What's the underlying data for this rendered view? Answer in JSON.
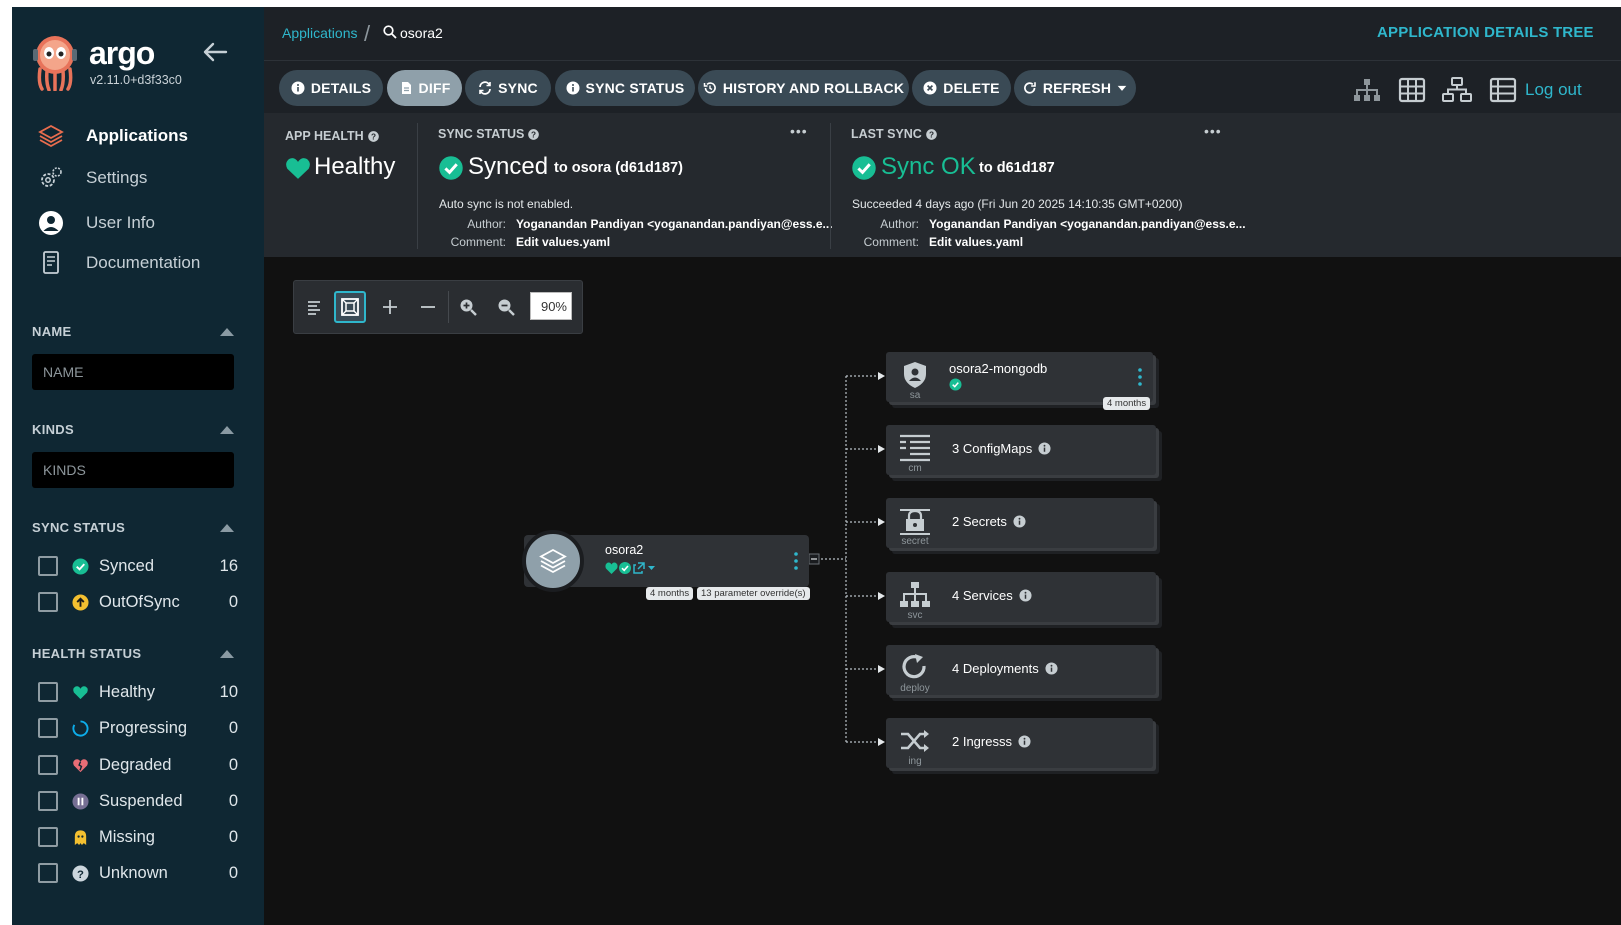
{
  "sidebar": {
    "brand": "argo",
    "version": "v2.11.0+d3f33c0",
    "nav": [
      {
        "label": "Applications",
        "icon": "layers-icon",
        "active": true
      },
      {
        "label": "Settings",
        "icon": "gear-icon"
      },
      {
        "label": "User Info",
        "icon": "user-circle-icon"
      },
      {
        "label": "Documentation",
        "icon": "book-icon"
      }
    ],
    "name_filter": {
      "title": "NAME",
      "placeholder": "NAME"
    },
    "kinds_filter": {
      "title": "KINDS",
      "placeholder": "KINDS"
    },
    "sync_status": {
      "title": "SYNC STATUS",
      "items": [
        {
          "label": "Synced",
          "count": "16",
          "icon": "check-circle-icon",
          "color": "#18be94"
        },
        {
          "label": "OutOfSync",
          "count": "0",
          "icon": "arrow-up-circle-icon",
          "color": "#f4c030"
        }
      ]
    },
    "health_status": {
      "title": "HEALTH STATUS",
      "items": [
        {
          "label": "Healthy",
          "count": "10",
          "icon": "heart-icon",
          "color": "#18be94"
        },
        {
          "label": "Progressing",
          "count": "0",
          "icon": "circle-notch-icon",
          "color": "#0dadea"
        },
        {
          "label": "Degraded",
          "count": "0",
          "icon": "heart-broken-icon",
          "color": "#e96d76"
        },
        {
          "label": "Suspended",
          "count": "0",
          "icon": "pause-circle-icon",
          "color": "#766f94"
        },
        {
          "label": "Missing",
          "count": "0",
          "icon": "ghost-icon",
          "color": "#f4c030"
        },
        {
          "label": "Unknown",
          "count": "0",
          "icon": "question-circle-icon",
          "color": "#ccd6dd"
        }
      ]
    }
  },
  "topbar": {
    "breadcrumb_link": "Applications",
    "breadcrumb_current": "osora2",
    "title": "APPLICATION DETAILS TREE"
  },
  "toolbar": {
    "details": "DETAILS",
    "diff": "DIFF",
    "sync": "SYNC",
    "sync_status": "SYNC STATUS",
    "history": "HISTORY AND ROLLBACK",
    "delete": "DELETE",
    "refresh": "REFRESH",
    "logout": "Log out"
  },
  "status": {
    "app_health": {
      "title": "APP HEALTH",
      "value": "Healthy"
    },
    "sync": {
      "title": "SYNC STATUS",
      "value": "Synced",
      "target": "to osora (d61d187)",
      "auto": "Auto sync is not enabled.",
      "author_label": "Author:",
      "author": "Yoganandan Pandiyan <yoganandan.pandiyan@ess.e...",
      "comment_label": "Comment:",
      "comment": "Edit values.yaml"
    },
    "last_sync": {
      "title": "LAST SYNC",
      "value": "Sync OK",
      "target": "to d61d187",
      "when": "Succeeded 4 days ago (Fri Jun 20 2025 14:10:35 GMT+0200)",
      "author_label": "Author:",
      "author": "Yoganandan Pandiyan <yoganandan.pandiyan@ess.e...",
      "comment_label": "Comment:",
      "comment": "Edit values.yaml"
    }
  },
  "graph": {
    "zoom": "90%",
    "app": {
      "name": "osora2",
      "age": "4 months",
      "overrides": "13 parameter override(s)"
    },
    "nodes": [
      {
        "name": "osora2-mongodb",
        "kind": "sa",
        "badge": "4 months"
      },
      {
        "name": "3 ConfigMaps",
        "kind": "cm"
      },
      {
        "name": "2 Secrets",
        "kind": "secret"
      },
      {
        "name": "4 Services",
        "kind": "svc"
      },
      {
        "name": "4 Deployments",
        "kind": "deploy"
      },
      {
        "name": "2 Ingresss",
        "kind": "ing"
      }
    ]
  },
  "colors": {
    "accent": "#2fb7cc",
    "healthy": "#18be94",
    "sidebar": "#0f2733"
  }
}
